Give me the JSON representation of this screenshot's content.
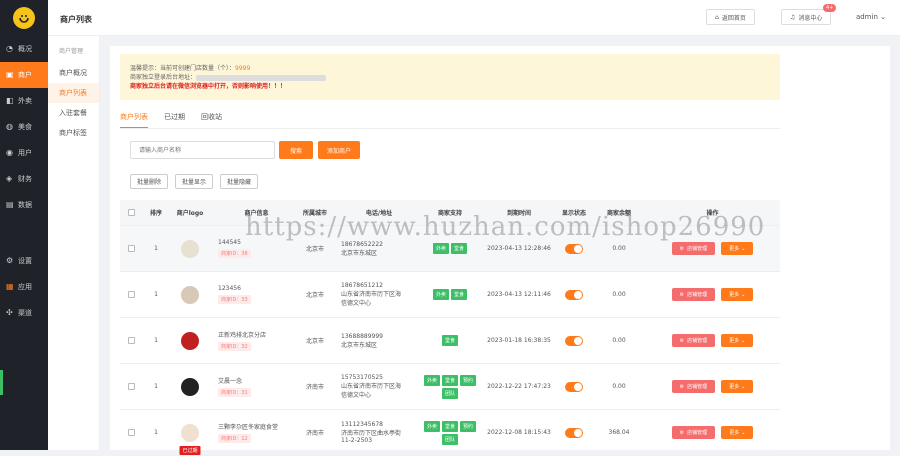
{
  "sidebar": {
    "items": [
      {
        "label": "概况",
        "icon": "gauge-icon"
      },
      {
        "label": "商户",
        "icon": "store-icon"
      },
      {
        "label": "外卖",
        "icon": "takeout-icon"
      },
      {
        "label": "美食",
        "icon": "food-icon"
      },
      {
        "label": "用户",
        "icon": "user-icon"
      },
      {
        "label": "财务",
        "icon": "finance-icon"
      },
      {
        "label": "数据",
        "icon": "chart-icon"
      },
      {
        "label": "设置",
        "icon": "gear-icon"
      },
      {
        "label": "应用",
        "icon": "apps-icon"
      },
      {
        "label": "渠道",
        "icon": "channel-icon"
      }
    ]
  },
  "submenu": {
    "heading": "商户管理",
    "items": [
      "商户概况",
      "商户列表",
      "入驻套餐",
      "商户标签"
    ]
  },
  "topbar": {
    "title": "商户列表",
    "back_label": "返回首页",
    "messages_label": "消息中心",
    "messages_badge": "4+",
    "user": "admin"
  },
  "notice": {
    "line1_prefix": "温馨提示：当前可创建门店数量（个）：",
    "line1_value": "9999",
    "line2": "商家独立登录后台地址：",
    "line3": "商家独立后台请在微信浏览器中打开，否则影响使用！！！"
  },
  "tabs": [
    "商户列表",
    "已过期",
    "回收站"
  ],
  "search": {
    "placeholder": "请输入商户名称",
    "search_label": "搜索",
    "add_label": "添加商户"
  },
  "bulk": [
    "批量删除",
    "批量显示",
    "批量隐藏"
  ],
  "columns": [
    "排序",
    "商户logo",
    "商户信息",
    "所属城市",
    "电话/地址",
    "商家支持",
    "到期时间",
    "显示状态",
    "商家余额",
    "操作"
  ],
  "rows": [
    {
      "sort": "1",
      "name": "144545",
      "mid": "商家ID：36",
      "city": "北京市",
      "phone": "18678652222",
      "addr": "北京市东城区",
      "addr2": "",
      "tags": [
        "外卖",
        "堂食"
      ],
      "expire": "2023-04-13 12:28:46",
      "balance": "0.00",
      "manage": "店铺管理",
      "more": "更多",
      "logo_color": "#e8e0d0",
      "expired_label": ""
    },
    {
      "sort": "1",
      "name": "123456",
      "mid": "商家ID：33",
      "city": "北京市",
      "phone": "18678651212",
      "addr": "山东省济南市历下区海",
      "addr2": "信德文中心",
      "tags": [
        "外卖",
        "堂食"
      ],
      "expire": "2023-04-13 12:11:46",
      "balance": "0.00",
      "manage": "店铺管理",
      "more": "更多",
      "logo_color": "#d8c8b8",
      "expired_label": ""
    },
    {
      "sort": "1",
      "name": "正新鸡排北京分店",
      "mid": "商家ID：32",
      "city": "北京市",
      "phone": "13688889999",
      "addr": "北京市东城区",
      "addr2": "",
      "tags": [
        "堂食"
      ],
      "expire": "2023-01-18 16:38:35",
      "balance": "0.00",
      "manage": "店铺管理",
      "more": "更多",
      "logo_color": "#c02020",
      "expired_label": ""
    },
    {
      "sort": "1",
      "name": "艾晨一念",
      "mid": "商家ID：31",
      "city": "济南市",
      "phone": "15753170525",
      "addr": "山东省济南市历下区海",
      "addr2": "信德文中心",
      "tags": [
        "外卖",
        "堂食",
        "预约",
        "团队"
      ],
      "expire": "2022-12-22 17:47:23",
      "balance": "0.00",
      "manage": "店铺管理",
      "more": "更多",
      "logo_color": "#222222",
      "expired_label": ""
    },
    {
      "sort": "1",
      "name": "三颗李尕匠冬家庭食堂",
      "mid": "商家ID：12",
      "city": "济南市",
      "phone": "13112345678",
      "addr": "济南市历下区曲水亭街",
      "addr2": "11-2-2503",
      "tags": [
        "外卖",
        "堂食",
        "预约",
        "团队"
      ],
      "expire": "2022-12-08 18:15:43",
      "balance": "368.04",
      "manage": "店铺管理",
      "more": "更多",
      "logo_color": "#f0e0d0",
      "expired_label": "已过期"
    }
  ],
  "watermark": "https://www.huzhan.com/ishop26990",
  "colors": {
    "accent": "#ff7a1a",
    "sidebar": "#1f2329",
    "tag": "#3cbf66",
    "danger": "#f56c6c"
  }
}
